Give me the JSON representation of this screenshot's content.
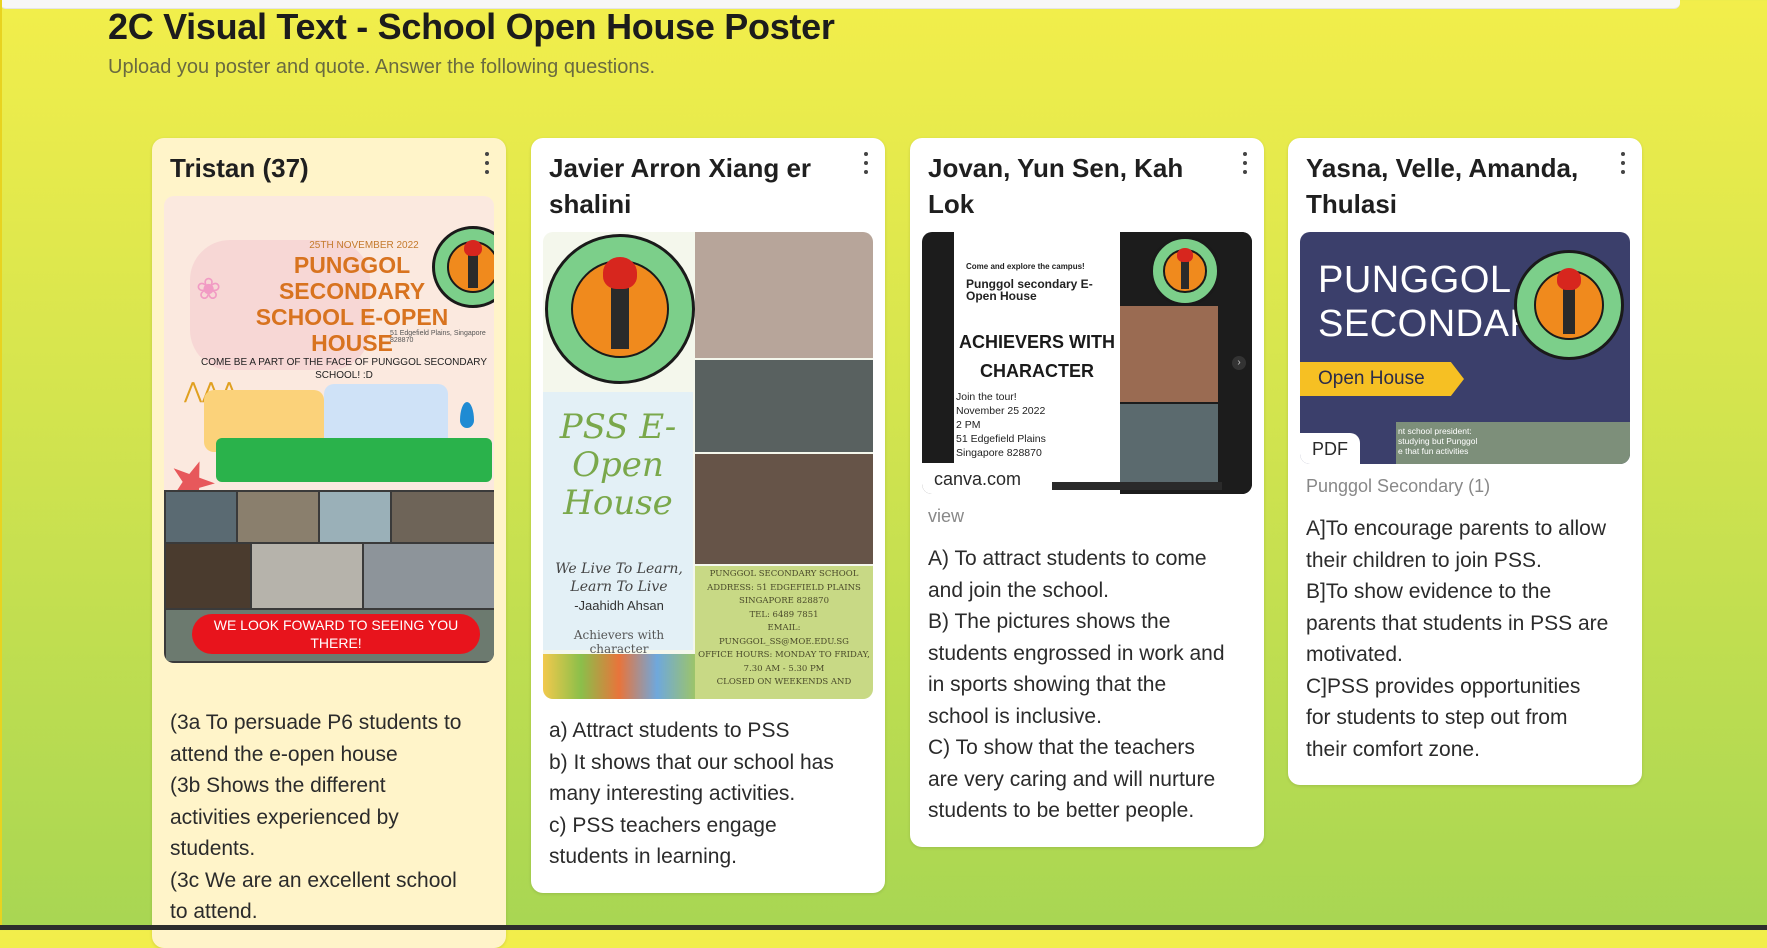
{
  "header": {
    "title": "2C Visual Text - School Open House Poster",
    "description": "Upload you poster and quote. Answer the following questions."
  },
  "colors": {
    "background_top": "#f2ee4b",
    "background_bottom": "#a8d653",
    "card_highlight": "#fff4c9",
    "card": "#ffffff"
  },
  "cards": [
    {
      "title": "Tristan (37)",
      "poster": {
        "date": "25TH NOVEMBER 2022",
        "heading": "PUNGGOL SECONDARY SCHOOL E-OPEN HOUSE",
        "address": "51 Edgefield Plains, Singapore 828870",
        "tagline": "COME BE A PART OF THE FACE OF PUNGGOL SECONDARY SCHOOL! :D",
        "banner": "WE LOOK FOWARD TO SEEING YOU THERE!"
      },
      "answers": [
        "(3a To persuade P6 students to",
        "attend the e-open house",
        "(3b Shows the different",
        "activities experienced by",
        "students.",
        "(3c We are an excellent school",
        "to attend."
      ]
    },
    {
      "title": "Javier Arron Xiang er shalini",
      "poster": {
        "script_title": "PSS E-Open House",
        "motto": "We Live To Learn, Learn To Live",
        "author": "-Jaahidh Ahsan",
        "achievers": "Achievers with character",
        "school": "PUNGGOL SECONDARY SCHOOL",
        "address": "ADDRESS: 51 EDGEFIELD PLAINS SINGAPORE 828870",
        "tel": "TEL: 6489 7851",
        "email_label": "EMAIL:",
        "email": "PUNGGOL_SS@MOE.EDU.SG",
        "hours": "OFFICE HOURS: MONDAY TO FRIDAY, 7.30 AM - 5.30 PM",
        "closed": "CLOSED ON WEEKENDS AND"
      },
      "answers": [
        "a) Attract students to PSS",
        "b) It shows that our school has",
        "many interesting activities.",
        "c) PSS teachers engage",
        "students in learning."
      ]
    },
    {
      "title": "Jovan, Yun Sen, Kah Lok",
      "poster": {
        "line1": "Come and explore the campus!",
        "line2": "Punggol secondary E-Open House",
        "heading": "ACHIEVERS WITH CHARACTER",
        "tour": "Join the tour!",
        "date": "November 25 2022",
        "time": "2 PM",
        "street": "51 Edgefield Plains",
        "city": "Singapore 828870"
      },
      "attachment_badge": "canva.com",
      "caption": "view",
      "answers": [
        "A) To attract students to come",
        "and join the school.",
        "B) The pictures shows the",
        "students engrossed in work and",
        "in sports showing that the",
        "school is inclusive.",
        "C) To show that the teachers",
        "are very caring and will nurture",
        "students to be better people."
      ]
    },
    {
      "title": "Yasna, Velle, Amanda, Thulasi",
      "poster": {
        "title_line1": "PUNGGOL",
        "title_line2": "SECONDARY",
        "ribbon": "Open House",
        "snippet1": "nt school president:",
        "snippet2": "studying but Punggol",
        "snippet3": "e that fun activities"
      },
      "attachment_badge": "PDF",
      "caption": "Punggol Secondary (1)",
      "answers": [
        "A]To encourage parents to allow",
        "their children to join PSS.",
        "B]To show evidence to the",
        "parents that students in PSS are",
        "motivated.",
        "C]PSS provides opportunities",
        "for students to step out from",
        "their comfort zone."
      ]
    }
  ],
  "icons": {
    "menu": "more-vertical-icon",
    "logo": "school-crest-icon"
  }
}
